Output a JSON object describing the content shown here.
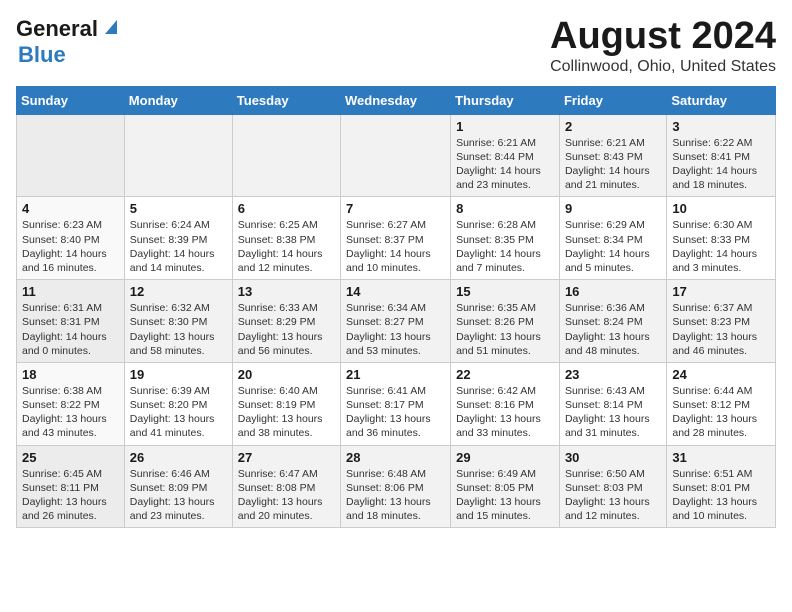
{
  "logo": {
    "line1": "General",
    "line2": "Blue"
  },
  "title": "August 2024",
  "subtitle": "Collinwood, Ohio, United States",
  "days_of_week": [
    "Sunday",
    "Monday",
    "Tuesday",
    "Wednesday",
    "Thursday",
    "Friday",
    "Saturday"
  ],
  "weeks": [
    [
      {
        "day": "",
        "info": ""
      },
      {
        "day": "",
        "info": ""
      },
      {
        "day": "",
        "info": ""
      },
      {
        "day": "",
        "info": ""
      },
      {
        "day": "1",
        "info": "Sunrise: 6:21 AM\nSunset: 8:44 PM\nDaylight: 14 hours and 23 minutes."
      },
      {
        "day": "2",
        "info": "Sunrise: 6:21 AM\nSunset: 8:43 PM\nDaylight: 14 hours and 21 minutes."
      },
      {
        "day": "3",
        "info": "Sunrise: 6:22 AM\nSunset: 8:41 PM\nDaylight: 14 hours and 18 minutes."
      }
    ],
    [
      {
        "day": "4",
        "info": "Sunrise: 6:23 AM\nSunset: 8:40 PM\nDaylight: 14 hours and 16 minutes."
      },
      {
        "day": "5",
        "info": "Sunrise: 6:24 AM\nSunset: 8:39 PM\nDaylight: 14 hours and 14 minutes."
      },
      {
        "day": "6",
        "info": "Sunrise: 6:25 AM\nSunset: 8:38 PM\nDaylight: 14 hours and 12 minutes."
      },
      {
        "day": "7",
        "info": "Sunrise: 6:27 AM\nSunset: 8:37 PM\nDaylight: 14 hours and 10 minutes."
      },
      {
        "day": "8",
        "info": "Sunrise: 6:28 AM\nSunset: 8:35 PM\nDaylight: 14 hours and 7 minutes."
      },
      {
        "day": "9",
        "info": "Sunrise: 6:29 AM\nSunset: 8:34 PM\nDaylight: 14 hours and 5 minutes."
      },
      {
        "day": "10",
        "info": "Sunrise: 6:30 AM\nSunset: 8:33 PM\nDaylight: 14 hours and 3 minutes."
      }
    ],
    [
      {
        "day": "11",
        "info": "Sunrise: 6:31 AM\nSunset: 8:31 PM\nDaylight: 14 hours and 0 minutes."
      },
      {
        "day": "12",
        "info": "Sunrise: 6:32 AM\nSunset: 8:30 PM\nDaylight: 13 hours and 58 minutes."
      },
      {
        "day": "13",
        "info": "Sunrise: 6:33 AM\nSunset: 8:29 PM\nDaylight: 13 hours and 56 minutes."
      },
      {
        "day": "14",
        "info": "Sunrise: 6:34 AM\nSunset: 8:27 PM\nDaylight: 13 hours and 53 minutes."
      },
      {
        "day": "15",
        "info": "Sunrise: 6:35 AM\nSunset: 8:26 PM\nDaylight: 13 hours and 51 minutes."
      },
      {
        "day": "16",
        "info": "Sunrise: 6:36 AM\nSunset: 8:24 PM\nDaylight: 13 hours and 48 minutes."
      },
      {
        "day": "17",
        "info": "Sunrise: 6:37 AM\nSunset: 8:23 PM\nDaylight: 13 hours and 46 minutes."
      }
    ],
    [
      {
        "day": "18",
        "info": "Sunrise: 6:38 AM\nSunset: 8:22 PM\nDaylight: 13 hours and 43 minutes."
      },
      {
        "day": "19",
        "info": "Sunrise: 6:39 AM\nSunset: 8:20 PM\nDaylight: 13 hours and 41 minutes."
      },
      {
        "day": "20",
        "info": "Sunrise: 6:40 AM\nSunset: 8:19 PM\nDaylight: 13 hours and 38 minutes."
      },
      {
        "day": "21",
        "info": "Sunrise: 6:41 AM\nSunset: 8:17 PM\nDaylight: 13 hours and 36 minutes."
      },
      {
        "day": "22",
        "info": "Sunrise: 6:42 AM\nSunset: 8:16 PM\nDaylight: 13 hours and 33 minutes."
      },
      {
        "day": "23",
        "info": "Sunrise: 6:43 AM\nSunset: 8:14 PM\nDaylight: 13 hours and 31 minutes."
      },
      {
        "day": "24",
        "info": "Sunrise: 6:44 AM\nSunset: 8:12 PM\nDaylight: 13 hours and 28 minutes."
      }
    ],
    [
      {
        "day": "25",
        "info": "Sunrise: 6:45 AM\nSunset: 8:11 PM\nDaylight: 13 hours and 26 minutes."
      },
      {
        "day": "26",
        "info": "Sunrise: 6:46 AM\nSunset: 8:09 PM\nDaylight: 13 hours and 23 minutes."
      },
      {
        "day": "27",
        "info": "Sunrise: 6:47 AM\nSunset: 8:08 PM\nDaylight: 13 hours and 20 minutes."
      },
      {
        "day": "28",
        "info": "Sunrise: 6:48 AM\nSunset: 8:06 PM\nDaylight: 13 hours and 18 minutes."
      },
      {
        "day": "29",
        "info": "Sunrise: 6:49 AM\nSunset: 8:05 PM\nDaylight: 13 hours and 15 minutes."
      },
      {
        "day": "30",
        "info": "Sunrise: 6:50 AM\nSunset: 8:03 PM\nDaylight: 13 hours and 12 minutes."
      },
      {
        "day": "31",
        "info": "Sunrise: 6:51 AM\nSunset: 8:01 PM\nDaylight: 13 hours and 10 minutes."
      }
    ]
  ]
}
